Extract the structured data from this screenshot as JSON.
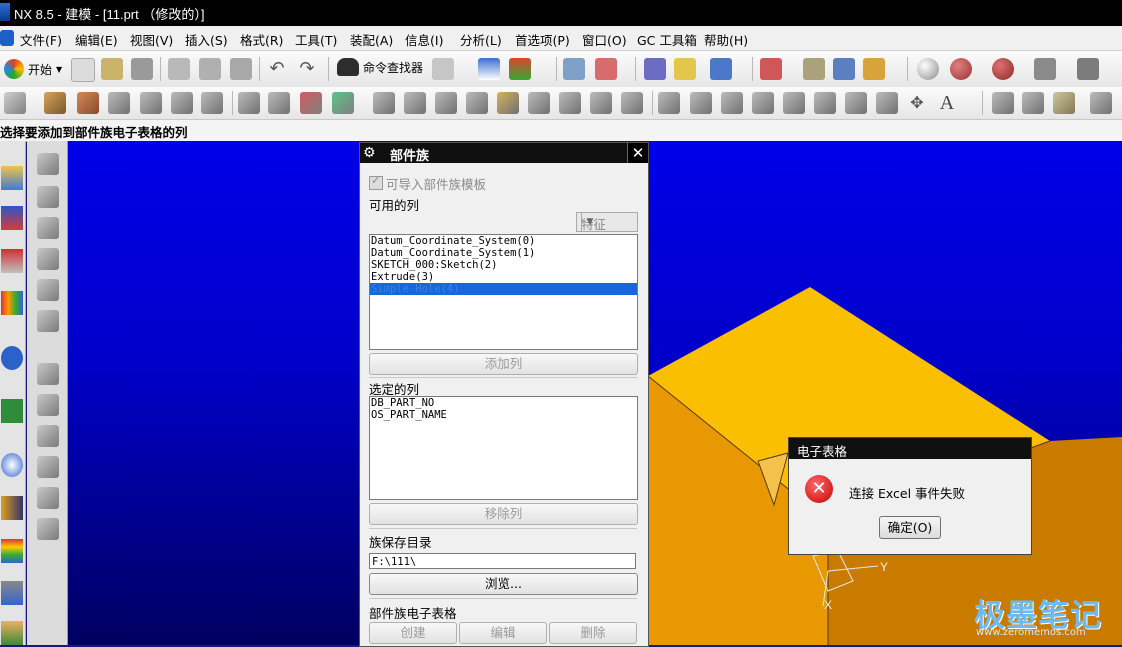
{
  "window": {
    "title": "NX 8.5 - 建模 - [11.prt （修改的）]"
  },
  "menu": {
    "items": [
      "文件(F)",
      "编辑(E)",
      "视图(V)",
      "插入(S)",
      "格式(R)",
      "工具(T)",
      "装配(A)",
      "信息(I)",
      "分析(L)",
      "首选项(P)",
      "窗口(O)",
      "GC 工具箱",
      "帮助(H)"
    ]
  },
  "toolbar": {
    "start_label": "开始",
    "command_finder_label": "命令查找器"
  },
  "cue_line": {
    "text": "选择要添加到部件族电子表格的列"
  },
  "part_family_dialog": {
    "title": "部件族",
    "import_template_label": "可导入部件族模板",
    "import_template_checked": true,
    "available_columns_label": "可用的列",
    "filter_combo_value": "特征",
    "available_columns": [
      "Datum_Coordinate_System(0)",
      "Datum_Coordinate_System(1)",
      "SKETCH_000:Sketch(2)",
      "Extrude(3)",
      "Simple Hole(4)"
    ],
    "selected_available_index": 4,
    "add_column_button": "添加列",
    "chosen_columns_label": "选定的列",
    "chosen_columns": [
      "DB_PART_NO",
      "OS_PART_NAME"
    ],
    "remove_column_button": "移除列",
    "save_dir_label": "族保存目录",
    "save_dir_value": "F:\\111\\",
    "browse_button": "浏览...",
    "spreadsheet_label": "部件族电子表格",
    "create_button": "创建",
    "edit_button": "编辑",
    "delete_button": "删除"
  },
  "message_box": {
    "title": "电子表格",
    "message": "连接 Excel 事件失败",
    "ok_button": "确定(O)"
  },
  "triad": {
    "y_label": "Y",
    "x_label": "X"
  },
  "watermark": {
    "title": "极墨笔记",
    "url": "www.zeromemos.com"
  },
  "colors": {
    "viewport_top": "#0000e8",
    "viewport_bottom": "#000060",
    "model_top": "#f9bf00",
    "model_front": "#e89800",
    "model_side": "#c97b00",
    "selection": "#1668d8"
  }
}
